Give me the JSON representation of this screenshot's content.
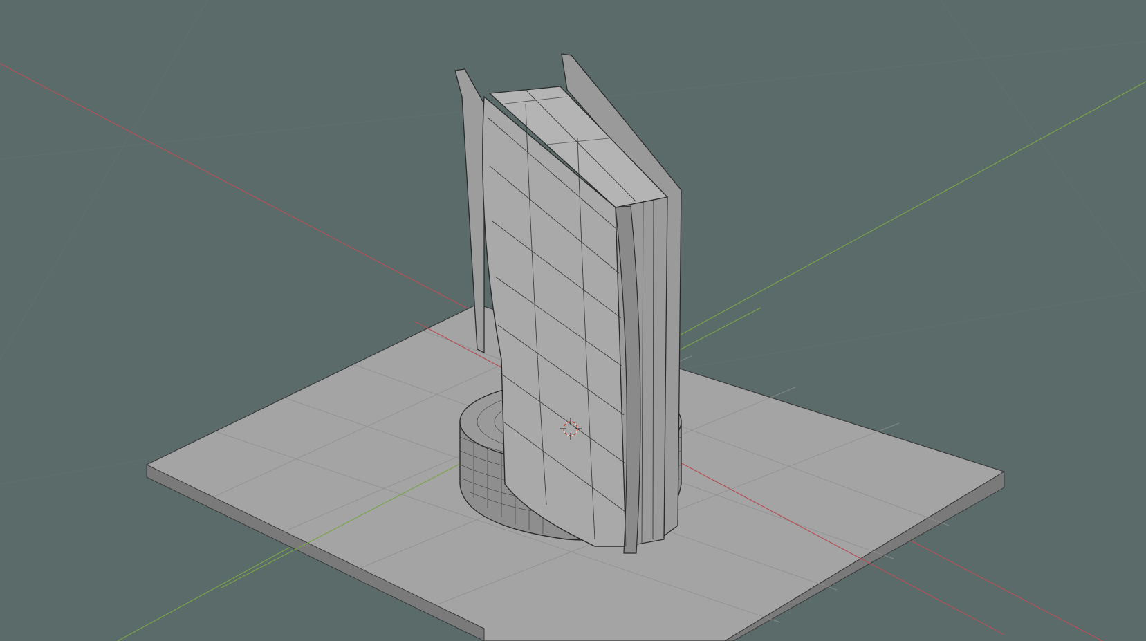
{
  "viewport": {
    "background_color": "#5b6b6a",
    "grid_color": "#687675",
    "x_axis_color": "#b4505a",
    "y_axis_color": "#7aa34a",
    "mesh_fill_color": "#a8a8a8",
    "mesh_wire_color": "#2b2b2b",
    "cursor_color": "#c0392b",
    "scene_objects": [
      "ground-plane",
      "console-body",
      "console-stand"
    ],
    "cursor_icon": "3d-cursor-icon",
    "shading_mode": "solid-wireframe"
  }
}
